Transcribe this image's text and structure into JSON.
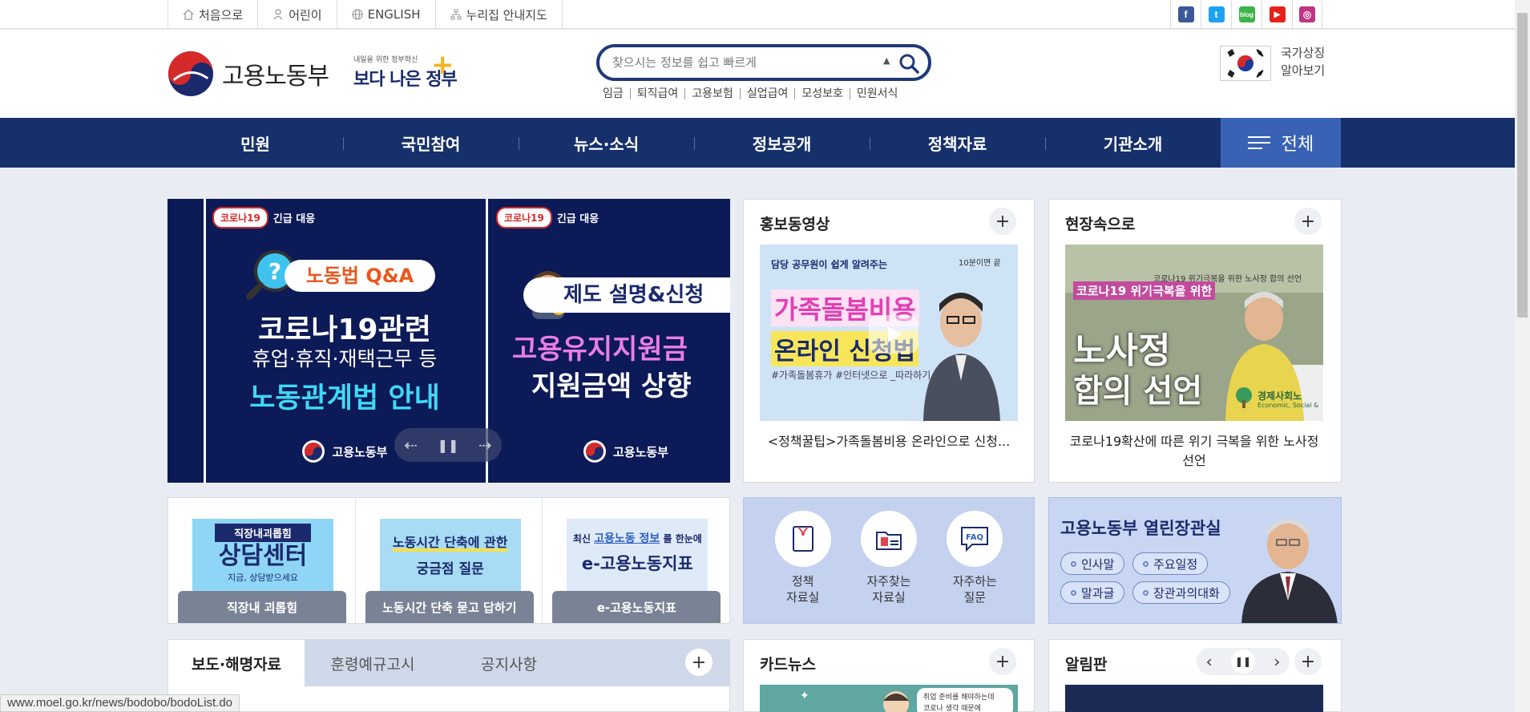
{
  "util_nav": [
    {
      "label": "처음으로",
      "icon": "home-icon"
    },
    {
      "label": "어린이",
      "icon": "child-icon"
    },
    {
      "label": "ENGLISH",
      "icon": "globe-icon"
    },
    {
      "label": "누리집 안내지도",
      "icon": "sitemap-icon"
    }
  ],
  "sns": [
    {
      "name": "facebook-icon",
      "glyph": "f",
      "color": "#3b5998"
    },
    {
      "name": "twitter-icon",
      "glyph": "t",
      "color": "#1da1f2"
    },
    {
      "name": "blog-icon",
      "glyph": "blog",
      "color": "#3cb449"
    },
    {
      "name": "youtube-icon",
      "glyph": "▶",
      "color": "#e62117"
    },
    {
      "name": "instagram-icon",
      "glyph": "◎",
      "color": "#c13584"
    }
  ],
  "header": {
    "logo_text": "고용노동부",
    "gov_small": "내일을 위한 정부혁신",
    "gov_big": "보다 나은 정부",
    "search_placeholder": "찾으시는 정보를 쉽고 빠르게",
    "keywords": [
      "임금",
      "퇴직급여",
      "고용보험",
      "실업급여",
      "모성보호",
      "민원서식"
    ],
    "flag_line1": "국가상징",
    "flag_line2": "알아보기"
  },
  "nav": {
    "items": [
      "민원",
      "국민참여",
      "뉴스·소식",
      "정보공개",
      "정책자료",
      "기관소개"
    ],
    "all_label": "전체"
  },
  "banner": {
    "slide1": {
      "tag_pill": "코로나19",
      "tag_label": "긴급 대응",
      "pill": "노동법 Q&A",
      "line1": "코로나19관련",
      "line2": "휴업·휴직·재택근무 등",
      "line3": "노동관계법 안내",
      "footer": "고용노동부"
    },
    "slide2": {
      "tag_pill": "코로나19",
      "tag_label": "긴급 대응",
      "pill": "제도 설명&신청",
      "line1": "고용유지지원금",
      "line2": "지원금액 상향",
      "footer": "고용노동부"
    },
    "controls": {
      "prev": "⇠",
      "pause": "❚❚",
      "next": "⇢"
    }
  },
  "video_card": {
    "title": "홍보동영상",
    "thumb_top": "담당 공무원이 쉽게 알려주는",
    "thumb_main1": "가족돌봄비용",
    "thumb_main2": "온라인 신청법",
    "thumb_hash": "#가족돌봄휴가 #인터넷으로 _따라하기",
    "thumb_corner": "10분이면 끝",
    "caption": "<정책꿀팁>가족돌봄비용 온라인으로 신청..."
  },
  "field_card": {
    "title": "현장속으로",
    "thumb_banner": "코로나19 위기극복을 위한 노사정 합의 선언",
    "thumb_tag": "코로나19 위기극복을 위한",
    "thumb_main1": "노사정",
    "thumb_main2": "합의 선언",
    "thumb_org": "경제사회노",
    "thumb_org_en": "Economic, Social &",
    "caption": "코로나19확산에 따른 위기 극복을 위한 노사정 선언"
  },
  "quick_links": [
    {
      "img_line1": "직장내괴롭힘",
      "img_line2": "상담센터",
      "img_line3": "지금, 상담받으세요",
      "button": "직장내 괴롭힘"
    },
    {
      "img_line1": "노동시간 단축에 관한",
      "img_line2": "궁금점 질문",
      "button": "노동시간 단축 묻고 답하기"
    },
    {
      "img_pre": "최신",
      "img_line1": "고용노동 정보",
      "img_post": "를 한눈에",
      "img_line2": "e-고용노동지표",
      "button": "e-고용노동지표"
    }
  ],
  "icon_links": [
    {
      "icon": "document-icon",
      "label": "정책\n자료실"
    },
    {
      "icon": "folder-icon",
      "label": "자주찾는\n자료실"
    },
    {
      "icon": "faq-icon",
      "label": "자주하는\n질문",
      "glyph": "FAQ"
    }
  ],
  "minister": {
    "title": "고용노동부 열린장관실",
    "tags": [
      "인사말",
      "주요일정",
      "말과글",
      "장관과의대화"
    ]
  },
  "news_tabs": {
    "tabs": [
      "보도·해명자료",
      "훈령예규고시",
      "공지사항"
    ]
  },
  "card_news": {
    "title": "카드뉴스",
    "thumb_text1": "취업 준비를 해야하는데",
    "thumb_text2": "코로나 생각 때문에"
  },
  "notice_board": {
    "title": "알림판",
    "prev": "‹",
    "pause": "❚❚",
    "next": "›"
  },
  "plus": "+",
  "status_url": "www.moel.go.kr/news/bodobo/bodoList.do"
}
